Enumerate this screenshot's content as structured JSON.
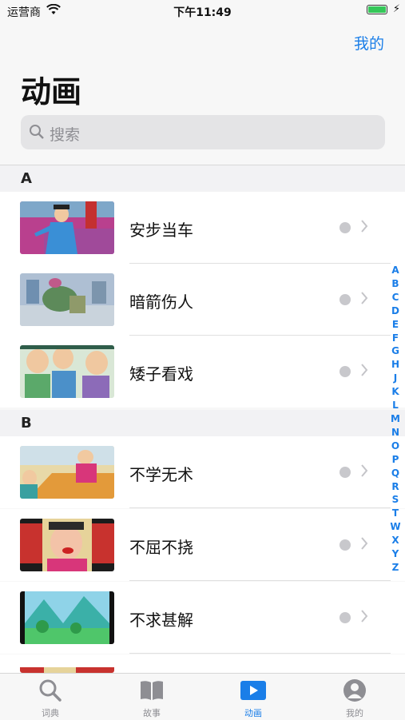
{
  "status_bar": {
    "carrier": "运营商",
    "time": "下午11:49"
  },
  "nav": {
    "right_button": "我的",
    "title": "动画"
  },
  "search": {
    "placeholder": "搜索"
  },
  "sections": [
    {
      "letter": "A",
      "items": [
        {
          "title": "安步当车",
          "thumb": "cartoon-man-walking"
        },
        {
          "title": "暗箭伤人",
          "thumb": "cartoon-battle-scene"
        },
        {
          "title": "矮子看戏",
          "thumb": "cartoon-crowd-watching"
        }
      ]
    },
    {
      "letter": "B",
      "items": [
        {
          "title": "不学无术",
          "thumb": "cartoon-room-scene"
        },
        {
          "title": "不屈不挠",
          "thumb": "cartoon-official-closeup"
        },
        {
          "title": "不求甚解",
          "thumb": "cartoon-landscape"
        }
      ]
    }
  ],
  "index_letters": [
    "A",
    "B",
    "C",
    "D",
    "E",
    "F",
    "G",
    "H",
    "J",
    "K",
    "L",
    "M",
    "N",
    "O",
    "P",
    "Q",
    "R",
    "S",
    "T",
    "W",
    "X",
    "Y",
    "Z"
  ],
  "tabs": [
    {
      "label": "词典",
      "icon": "search-icon"
    },
    {
      "label": "故事",
      "icon": "book-icon"
    },
    {
      "label": "动画",
      "icon": "play-icon",
      "active": true
    },
    {
      "label": "我的",
      "icon": "person-icon"
    }
  ],
  "colors": {
    "accent": "#1a7ee8",
    "battery": "#35c759"
  }
}
